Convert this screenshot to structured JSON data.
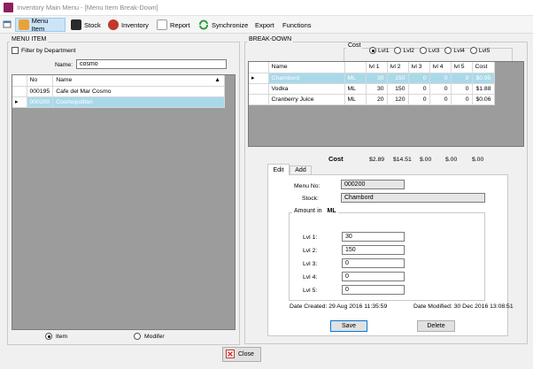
{
  "window": {
    "title": "Inventory Main Menu - [Menu Item Break-Down]"
  },
  "menu": [
    {
      "label": "Menu Item",
      "icon": "menu-item-icon",
      "color": "#e9a23b"
    },
    {
      "label": "Stock",
      "icon": "stock-icon",
      "color": "#2a2a2a"
    },
    {
      "label": "Inventory",
      "icon": "inventory-icon",
      "color": "#c0392b"
    },
    {
      "label": "Report",
      "icon": "report-icon",
      "color": "#9e9e9e"
    },
    {
      "label": "Synchronize",
      "icon": "synchronize-icon",
      "color": "#2e9e3a"
    },
    {
      "label": "Export",
      "icon": "",
      "color": ""
    },
    {
      "label": "Functions",
      "icon": "",
      "color": ""
    }
  ],
  "menu_item_panel": {
    "group_label": "MENU ITEM",
    "filter_label": "Filter by Department",
    "name_label": "Name:",
    "name_value": "cosmo",
    "columns": [
      "No",
      "Name"
    ],
    "rows": [
      {
        "no": "000195",
        "name": "Cafe del Mar Cosmo"
      },
      {
        "no": "000200",
        "name": "Cosmopolitan"
      }
    ],
    "radio_item": "Item",
    "radio_modifier": "Modifer"
  },
  "breakdown_panel": {
    "group_label": "BREAK-DOWN",
    "cost_label": "Cost",
    "cost_levels": [
      "Lvl1",
      "Lvl2",
      "Lvl3",
      "Lvl4",
      "Lvl5"
    ],
    "columns": [
      "Name",
      "",
      "lvl 1",
      "lvl 2",
      "lvl 3",
      "lvl 4",
      "lvl 5",
      "Cost"
    ],
    "rows": [
      {
        "name": "Chambord",
        "unit": "ML",
        "l1": "30",
        "l2": "150",
        "l3": "0",
        "l4": "0",
        "l5": "0",
        "cost": "$0.95"
      },
      {
        "name": "Vodka",
        "unit": "ML",
        "l1": "30",
        "l2": "150",
        "l3": "0",
        "l4": "0",
        "l5": "0",
        "cost": "$1.88"
      },
      {
        "name": "Cranberry Juice",
        "unit": "ML",
        "l1": "20",
        "l2": "120",
        "l3": "0",
        "l4": "0",
        "l5": "0",
        "cost": "$0.06"
      }
    ],
    "totals_label": "Cost",
    "totals": [
      "$2.89",
      "$14.51",
      "$.00",
      "$.00",
      "$.00"
    ]
  },
  "edit_panel": {
    "tabs": [
      "Edit",
      "Add"
    ],
    "menu_no_label": "Menu No:",
    "menu_no_value": "000200",
    "stock_label": "Stock:",
    "stock_value": "Chambord",
    "amount_label": "Amount in",
    "amount_unit": "ML",
    "levels": [
      {
        "label": "Lvl 1:",
        "value": "30"
      },
      {
        "label": "Lvl 2:",
        "value": "150"
      },
      {
        "label": "Lvl 3:",
        "value": "0"
      },
      {
        "label": "Lvl 4:",
        "value": "0"
      },
      {
        "label": "Lvl 5:",
        "value": "0"
      }
    ],
    "date_created": "Date Created:  29 Aug 2016 11:35:59",
    "date_modified": "Date Modified:  30 Dec 2016 13:08:51",
    "save_label": "Save",
    "delete_label": "Delete"
  },
  "close_label": "Close"
}
